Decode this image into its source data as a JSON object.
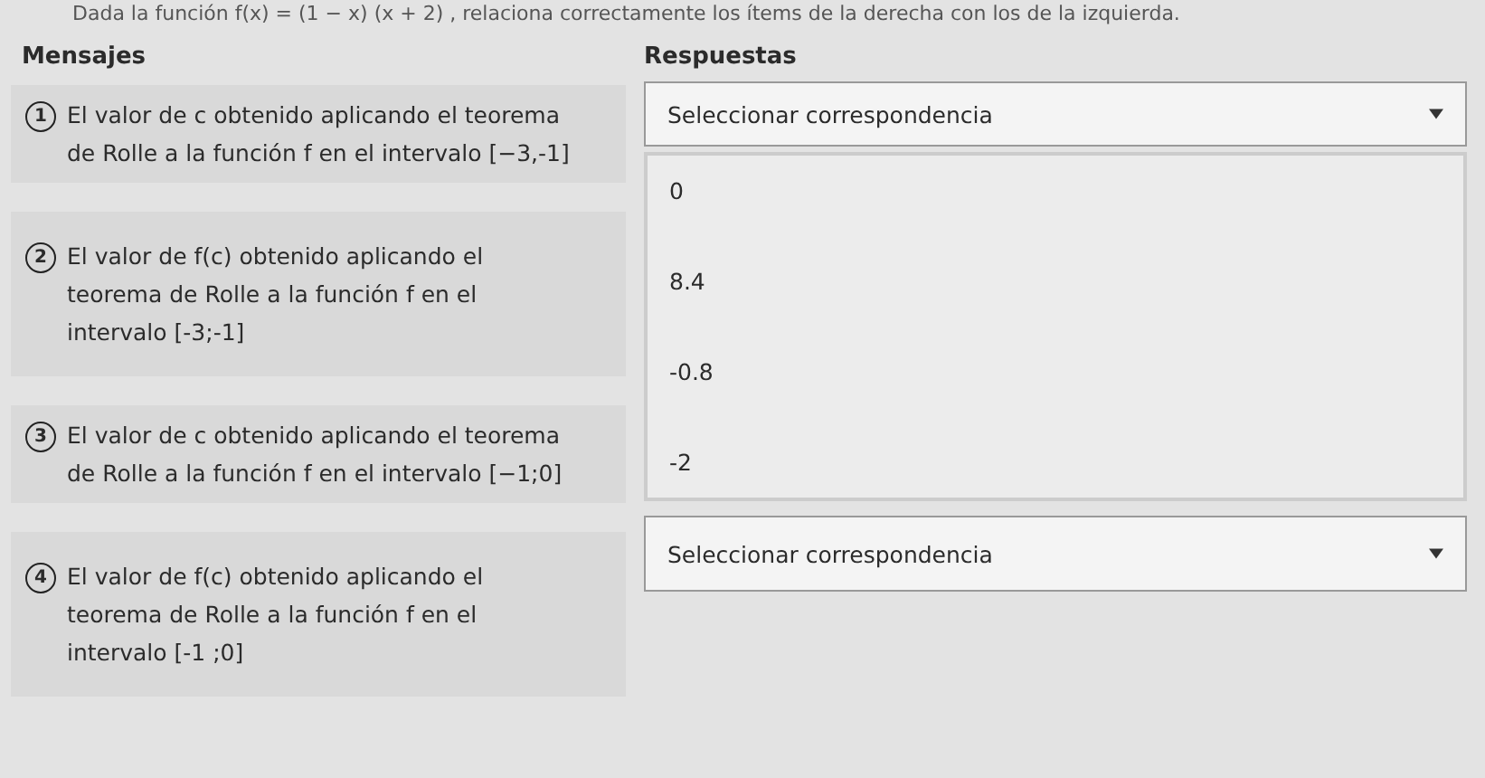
{
  "instruction": "Dada la función f(x) = (1 − x) (x + 2) , relaciona correctamente los ítems de la derecha con los de la izquierda.",
  "headers": {
    "left": "Mensajes",
    "right": "Respuestas"
  },
  "messages": [
    {
      "number": "1",
      "text": "El valor de c obtenido aplicando el teorema de Rolle a la función f en el intervalo [−3,-1]"
    },
    {
      "number": "2",
      "text": "El valor de f(c) obtenido aplicando el teorema de Rolle a la función f en el intervalo [-3;-1]"
    },
    {
      "number": "3",
      "text": "El valor de c obtenido aplicando el teorema de Rolle a la función f en el intervalo [−1;0]"
    },
    {
      "number": "4",
      "text": "El valor de f(c) obtenido aplicando el teorema de Rolle a la función f en el intervalo [-1 ;0]"
    }
  ],
  "dropdowns": [
    {
      "placeholder": "Seleccionar correspondencia",
      "options": [
        "0",
        "8.4",
        "-0.8",
        "-2"
      ]
    },
    {
      "placeholder": "Seleccionar correspondencia"
    }
  ]
}
